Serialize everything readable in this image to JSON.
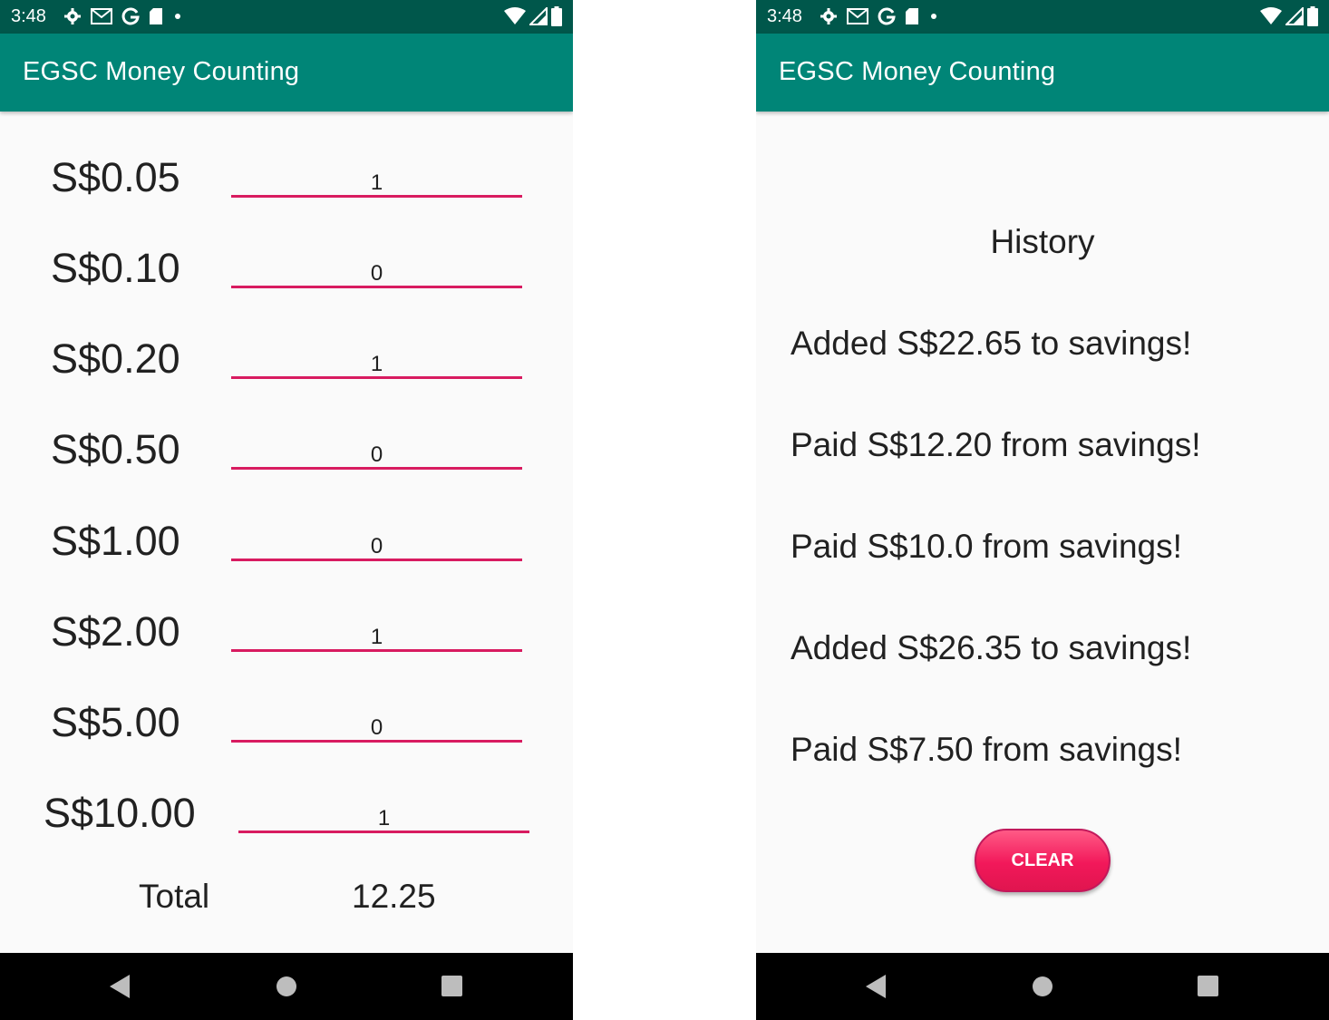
{
  "status_bar": {
    "time": "3:48",
    "left_icons": [
      "settings-gear-icon",
      "gmail-icon",
      "google-icon",
      "sd-card-icon",
      "notification-dot-icon"
    ],
    "right_icons": [
      "wifi-icon",
      "cell-signal-icon",
      "battery-icon"
    ]
  },
  "app_bar": {
    "title": "EGSC Money Counting"
  },
  "counter_screen": {
    "rows": [
      {
        "label": "S$0.05",
        "value": "1"
      },
      {
        "label": "S$0.10",
        "value": "0"
      },
      {
        "label": "S$0.20",
        "value": "1"
      },
      {
        "label": "S$0.50",
        "value": "0"
      },
      {
        "label": "S$1.00",
        "value": "0"
      },
      {
        "label": "S$2.00",
        "value": "1"
      },
      {
        "label": "S$5.00",
        "value": "0"
      },
      {
        "label": "S$10.00",
        "value": "1"
      }
    ],
    "total_label": "Total",
    "total_value": "12.25"
  },
  "history_screen": {
    "title": "History",
    "items": [
      "Added S$22.65 to savings!",
      "Paid S$12.20 from savings!",
      "Paid S$10.0 from savings!",
      "Added S$26.35 to savings!",
      "Paid S$7.50 from savings!"
    ],
    "clear_label": "CLEAR"
  },
  "colors": {
    "primary_dark": "#00574b",
    "primary": "#008577",
    "accent": "#d81b60"
  },
  "nav_bar": {
    "icons": [
      "back-triangle-icon",
      "home-circle-icon",
      "recents-square-icon"
    ]
  }
}
